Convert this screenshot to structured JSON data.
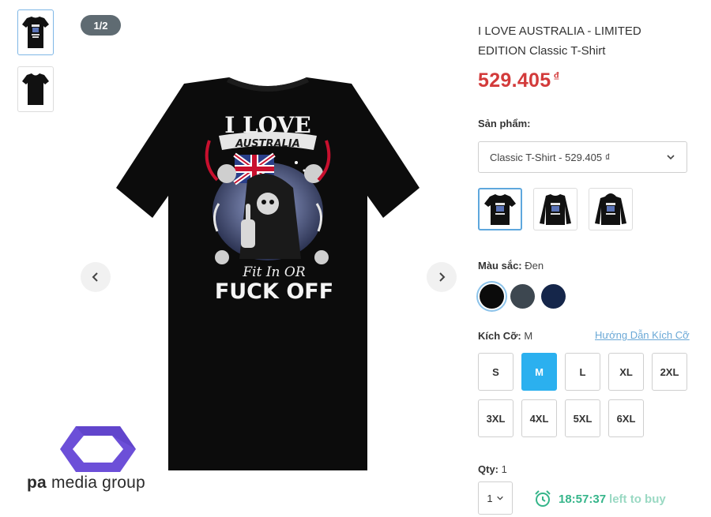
{
  "gallery": {
    "counter": "1/2",
    "shirt_print": {
      "line1": "I LOVE",
      "banner": "AUSTRALIA",
      "line3": "Fit In OR",
      "line4": "FUCK OFF"
    }
  },
  "brand": {
    "logo_text_bold": "pa",
    "logo_text_rest": " media group"
  },
  "product": {
    "title": "I LOVE AUSTRALIA - LIMITED EDITION Classic T-Shirt",
    "price": "529.405",
    "currency": "₫"
  },
  "options": {
    "product_label": "Sản phẩm:",
    "product_selected": "Classic T-Shirt - 529.405 ₫",
    "color_label": "Màu sắc:",
    "color_value": "Đen",
    "colors": [
      "#0b0b0b",
      "#3d4750",
      "#15264a"
    ],
    "size_label": "Kích Cỡ:",
    "size_value": "M",
    "size_guide": "Hướng Dẫn Kích Cỡ",
    "sizes": [
      "S",
      "M",
      "L",
      "XL",
      "2XL",
      "3XL",
      "4XL",
      "5XL",
      "6XL"
    ],
    "qty_label": "Qty:",
    "qty_value": "1"
  },
  "timer": {
    "time": "18:57:37",
    "suffix": "left to buy"
  },
  "theme": {
    "price_color": "#d33b3b",
    "accent": "#2bb0ef",
    "timer_color": "#35b58a"
  }
}
